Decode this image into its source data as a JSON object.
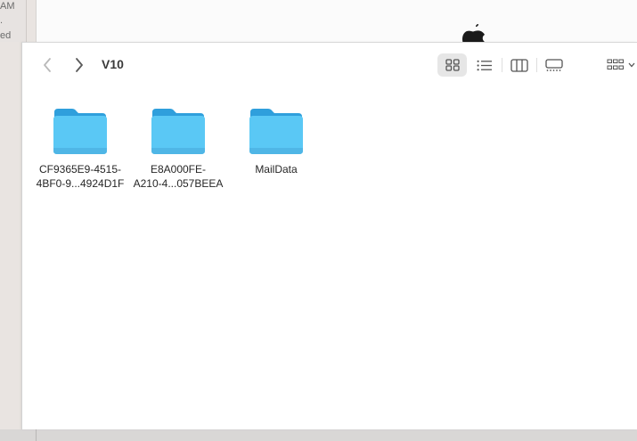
{
  "background_window": {
    "left_strip_lines": [
      "AM",
      ".",
      "ed"
    ]
  },
  "finder": {
    "title": "V10",
    "toolbar": {
      "back_icon": "chevron-left-icon",
      "forward_icon": "chevron-right-icon",
      "view_modes": [
        "icons",
        "list",
        "columns",
        "gallery"
      ],
      "active_view": "icons",
      "group_icon": "group-grid-icon"
    },
    "items": [
      {
        "name": "CF9365E9-4515-\n4BF0-9...4924D1F",
        "kind": "folder"
      },
      {
        "name": "E8A000FE-\nA210-4...057BEEA",
        "kind": "folder"
      },
      {
        "name": "MailData",
        "kind": "folder"
      }
    ]
  },
  "colors": {
    "folder_body": "#5ac8f5",
    "folder_tab": "#2f9fdc",
    "accent": "#0a84ff"
  }
}
